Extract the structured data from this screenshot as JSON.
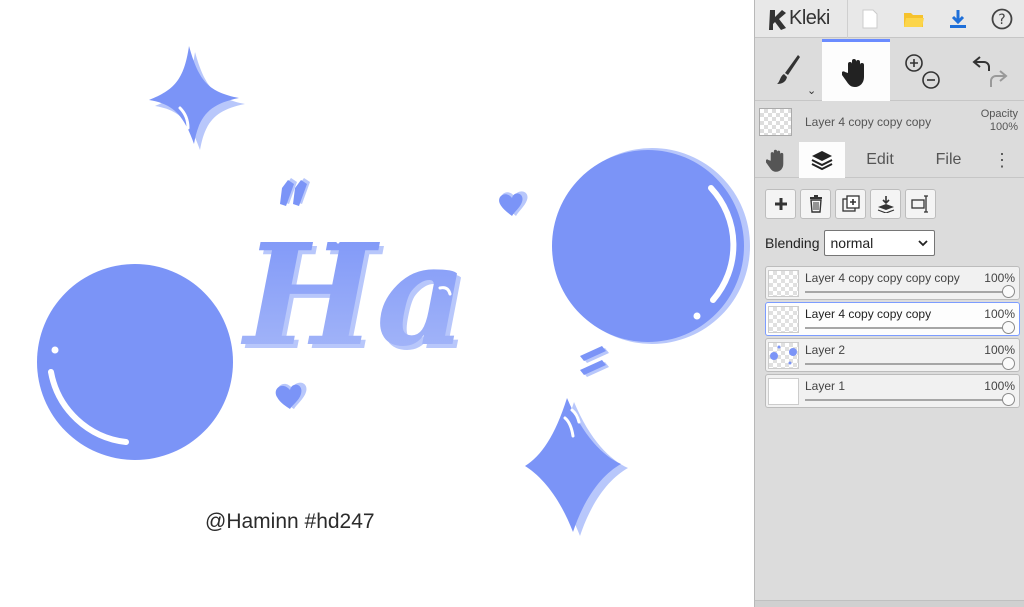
{
  "app": {
    "name": "Kleki",
    "icons": [
      "kleki-logo-icon",
      "new-image-icon",
      "open-folder-icon",
      "download-icon",
      "help-icon"
    ]
  },
  "canvas": {
    "signature": "@Haminn #hd247",
    "lettering": "Ha",
    "colors": {
      "shape": "#7b94f7",
      "shadow": "#b8c7fb",
      "highlight": "#ffffff"
    }
  },
  "tools": {
    "items": [
      {
        "name": "brush-tool",
        "icon": "brush-icon",
        "active": false
      },
      {
        "name": "hand-tool",
        "icon": "hand-icon",
        "active": true
      },
      {
        "name": "zoom-tool",
        "icon": "zoom-in-out-icon",
        "active": false
      },
      {
        "name": "undo-redo",
        "icon": "undo-redo-icon",
        "active": false
      }
    ]
  },
  "current_layer": {
    "name": "Layer 4 copy copy copy",
    "opacity_label": "Opacity",
    "opacity_value": "100%"
  },
  "tabs": {
    "edit": "Edit",
    "file": "File"
  },
  "blending": {
    "label": "Blending",
    "value": "normal"
  },
  "layers": [
    {
      "name": "Layer 4 copy copy copy copy",
      "opacity": "100%",
      "opacity_fraction": 1.0,
      "active": false
    },
    {
      "name": "Layer 4 copy copy copy",
      "opacity": "100%",
      "opacity_fraction": 1.0,
      "active": true
    },
    {
      "name": "Layer 2",
      "opacity": "100%",
      "opacity_fraction": 1.0,
      "active": false
    },
    {
      "name": "Layer 1",
      "opacity": "100%",
      "opacity_fraction": 1.0,
      "active": false
    }
  ]
}
